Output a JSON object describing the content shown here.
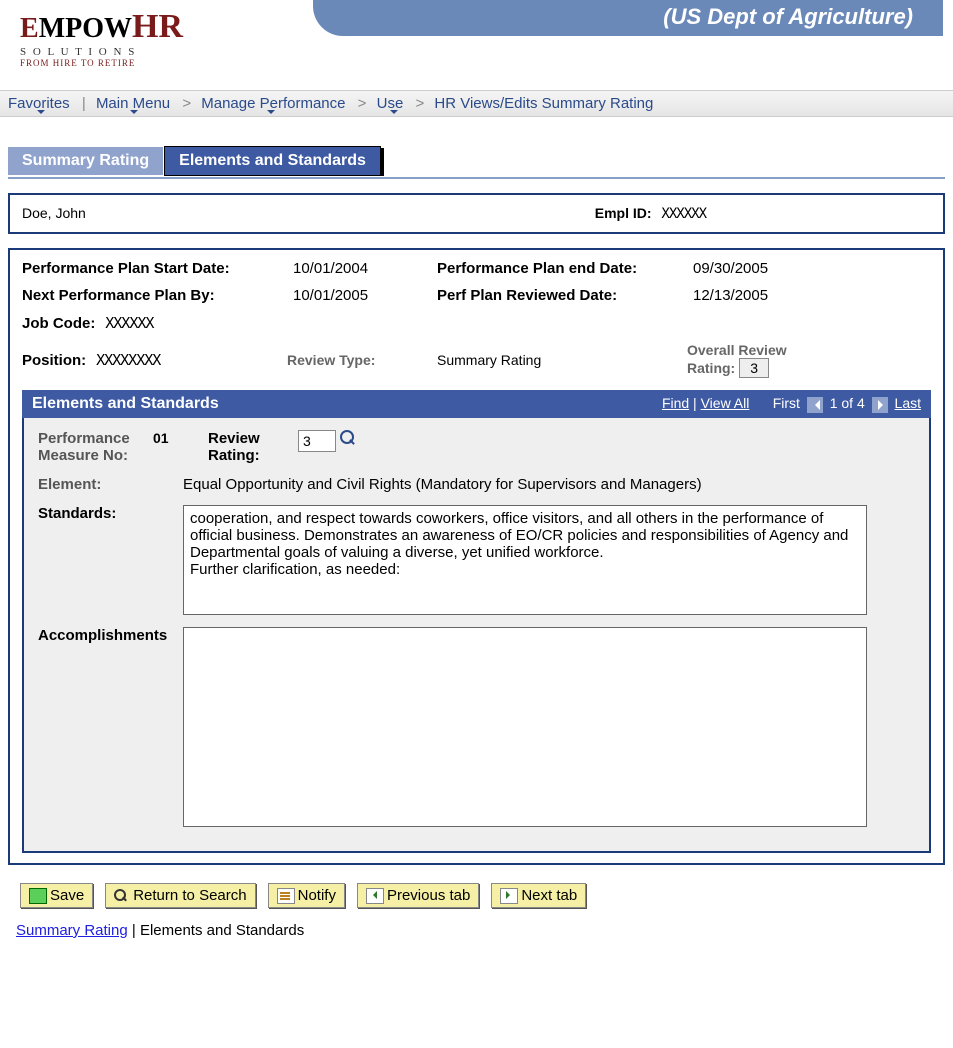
{
  "header": {
    "org_title": "(US Dept of Agriculture)",
    "logo_top_a": "E",
    "logo_top_b": "MPOW",
    "logo_top_c": "HR",
    "logo_mid": "S  O  L  U  T  I  O  N  S",
    "logo_bot": "FROM HIRE TO RETIRE"
  },
  "breadcrumb": {
    "favorites": "Favorites",
    "main_menu": "Main Menu",
    "manage_perf": "Manage Performance",
    "use": "Use",
    "page": "HR Views/Edits Summary Rating"
  },
  "tabs": {
    "summary": "Summary Rating",
    "elements": "Elements and Standards"
  },
  "employee": {
    "name": "Doe, John",
    "empl_id_label": "Empl ID:",
    "empl_id": "XXXXXX"
  },
  "plan": {
    "start_label": "Performance Plan Start Date:",
    "start_val": "10/01/2004",
    "end_label": "Performance Plan end Date:",
    "end_val": "09/30/2005",
    "next_label": "Next Performance Plan By:",
    "next_val": "10/01/2005",
    "reviewed_label": "Perf Plan Reviewed Date:",
    "reviewed_val": "12/13/2005",
    "jobcode_label": "Job Code:",
    "jobcode_val": "XXXXXX",
    "position_label": "Position:",
    "position_val": "XXXXXXXX",
    "review_type_label": "Review Type:",
    "review_type_val": "Summary Rating",
    "overall_label": "Overall Review Rating:",
    "overall_val": "3"
  },
  "panel": {
    "title": "Elements and Standards",
    "find": "Find",
    "view_all": "View All",
    "first": "First",
    "counter": "1 of 4",
    "last": "Last",
    "measure_label": "Performance Measure No:",
    "measure_no": "01",
    "review_rating_label": "Review Rating:",
    "review_rating_val": "3",
    "element_label": "Element:",
    "element_val": "Equal Opportunity and Civil Rights (Mandatory for Supervisors and Managers)",
    "standards_label": "Standards:",
    "standards_val": "cooperation, and respect towards coworkers, office visitors, and all others in the performance of official business. Demonstrates an awareness of EO/CR policies and responsibilities of Agency and Departmental goals of valuing a diverse, yet unified workforce.\nFurther clarification, as needed:",
    "accomp_label": "Accomplishments",
    "accomp_val": ""
  },
  "buttons": {
    "save": "Save",
    "return": "Return to Search",
    "notify": "Notify",
    "prev_tab": "Previous tab",
    "next_tab": "Next tab"
  },
  "bottom": {
    "summary": "Summary Rating",
    "sep": " | ",
    "elements": "Elements and Standards"
  }
}
